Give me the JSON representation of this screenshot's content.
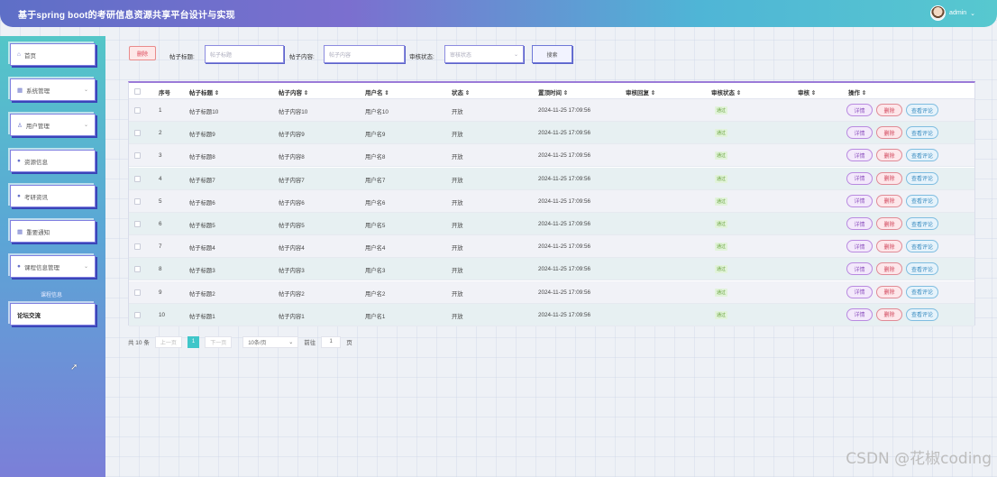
{
  "header": {
    "title": "基于spring boot的考研信息资源共享平台设计与实现",
    "user": "admin",
    "dropdown_icon": "chevron-down-icon"
  },
  "sidebar": {
    "items": [
      {
        "label": "首页",
        "icon": "home-icon",
        "has_submenu": false
      },
      {
        "label": "系统管理",
        "icon": "grid-icon",
        "has_submenu": true
      },
      {
        "label": "用户管理",
        "icon": "user-icon",
        "has_submenu": true
      },
      {
        "label": "资源信息",
        "icon": "dot-icon",
        "has_submenu": false
      },
      {
        "label": "考研资讯",
        "icon": "dot-icon",
        "has_submenu": false
      },
      {
        "label": "重要通知",
        "icon": "grid-icon",
        "has_submenu": false
      },
      {
        "label": "课程信息管理",
        "icon": "dot-icon",
        "has_submenu": true
      },
      {
        "label": "论坛交流",
        "icon": "",
        "has_submenu": false
      }
    ],
    "sub_label": "课程信息"
  },
  "toolbar": {
    "delete_label": "删除",
    "title_label": "帖子标题:",
    "title_placeholder": "帖子标题",
    "content_label": "帖子内容:",
    "content_placeholder": "帖子内容",
    "audit_label": "审核状态:",
    "audit_placeholder": "审核状态",
    "search_label": "搜索"
  },
  "table": {
    "headers": [
      "序号",
      "帖子标题 ⇕",
      "帖子内容 ⇕",
      "用户名 ⇕",
      "状态 ⇕",
      "置顶时间 ⇕",
      "审核回复 ⇕",
      "审核状态 ⇕",
      "审核 ⇕",
      "操作 ⇕"
    ],
    "rows": [
      {
        "no": "1",
        "title": "帖子标题10",
        "content": "帖子内容10",
        "user": "用户名10",
        "status": "开放",
        "time": "2024-11-25 17:09:56",
        "reply": "",
        "audit": "通过"
      },
      {
        "no": "2",
        "title": "帖子标题9",
        "content": "帖子内容9",
        "user": "用户名9",
        "status": "开放",
        "time": "2024-11-25 17:09:56",
        "reply": "",
        "audit": "通过"
      },
      {
        "no": "3",
        "title": "帖子标题8",
        "content": "帖子内容8",
        "user": "用户名8",
        "status": "开放",
        "time": "2024-11-25 17:09:56",
        "reply": "",
        "audit": "通过"
      },
      {
        "no": "4",
        "title": "帖子标题7",
        "content": "帖子内容7",
        "user": "用户名7",
        "status": "开放",
        "time": "2024-11-25 17:09:56",
        "reply": "",
        "audit": "通过"
      },
      {
        "no": "5",
        "title": "帖子标题6",
        "content": "帖子内容6",
        "user": "用户名6",
        "status": "开放",
        "time": "2024-11-25 17:09:56",
        "reply": "",
        "audit": "通过"
      },
      {
        "no": "6",
        "title": "帖子标题5",
        "content": "帖子内容5",
        "user": "用户名5",
        "status": "开放",
        "time": "2024-11-25 17:09:56",
        "reply": "",
        "audit": "通过"
      },
      {
        "no": "7",
        "title": "帖子标题4",
        "content": "帖子内容4",
        "user": "用户名4",
        "status": "开放",
        "time": "2024-11-25 17:09:56",
        "reply": "",
        "audit": "通过"
      },
      {
        "no": "8",
        "title": "帖子标题3",
        "content": "帖子内容3",
        "user": "用户名3",
        "status": "开放",
        "time": "2024-11-25 17:09:56",
        "reply": "",
        "audit": "通过"
      },
      {
        "no": "9",
        "title": "帖子标题2",
        "content": "帖子内容2",
        "user": "用户名2",
        "status": "开放",
        "time": "2024-11-25 17:09:56",
        "reply": "",
        "audit": "通过"
      },
      {
        "no": "10",
        "title": "帖子标题1",
        "content": "帖子内容1",
        "user": "用户名1",
        "status": "开放",
        "time": "2024-11-25 17:09:56",
        "reply": "",
        "audit": "通过"
      }
    ],
    "actions": {
      "detail": "详情",
      "delete": "删除",
      "comments": "查看评论"
    }
  },
  "pagination": {
    "total": "共 10 条",
    "prev": "上一页",
    "current": "1",
    "next": "下一页",
    "page_size": "10条/页",
    "goto_label": "前往",
    "goto_value": "1",
    "page_unit": "页"
  },
  "watermark": "CSDN @花椒coding",
  "colors": {
    "accent": "#3fc6c9",
    "brand": "#7b6fcf",
    "sidebar_top": "#54c6c8",
    "sidebar_bottom": "#7b7fd8"
  }
}
